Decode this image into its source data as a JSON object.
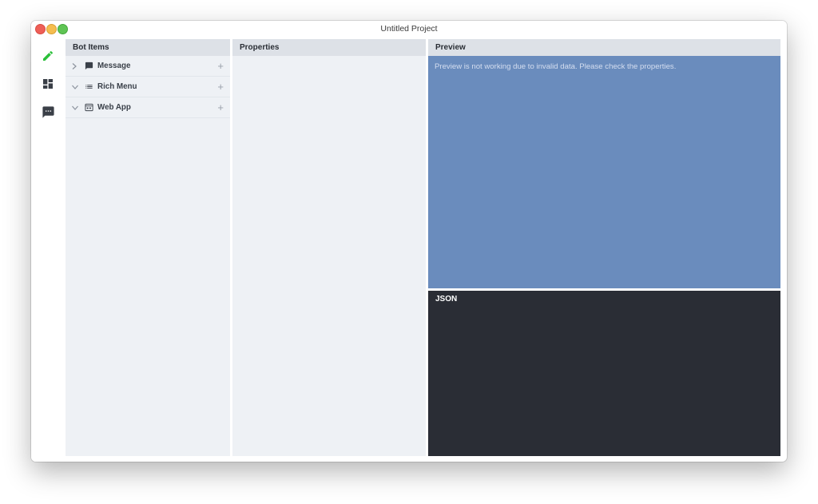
{
  "window": {
    "title": "Untitled Project"
  },
  "activity_bar": {
    "items": [
      {
        "icon": "pencil-icon",
        "active": true,
        "color": "#2bc03a"
      },
      {
        "icon": "dashboard-icon",
        "active": false,
        "color": "#3a3f47"
      },
      {
        "icon": "chat-icon",
        "active": false,
        "color": "#3a3f47"
      }
    ]
  },
  "bot_items": {
    "header": "Bot Items",
    "rows": [
      {
        "label": "Message",
        "expanded": false,
        "icon": "message-icon"
      },
      {
        "label": "Rich Menu",
        "expanded": true,
        "icon": "list-icon"
      },
      {
        "label": "Web App",
        "expanded": true,
        "icon": "webapp-icon"
      }
    ]
  },
  "properties": {
    "header": "Properties"
  },
  "preview": {
    "header": "Preview",
    "message": "Preview is not working due to invalid data. Please check the properties.",
    "bg_color": "#6a8cbd"
  },
  "json_panel": {
    "header": "JSON",
    "bg_color": "#2a2d35"
  }
}
